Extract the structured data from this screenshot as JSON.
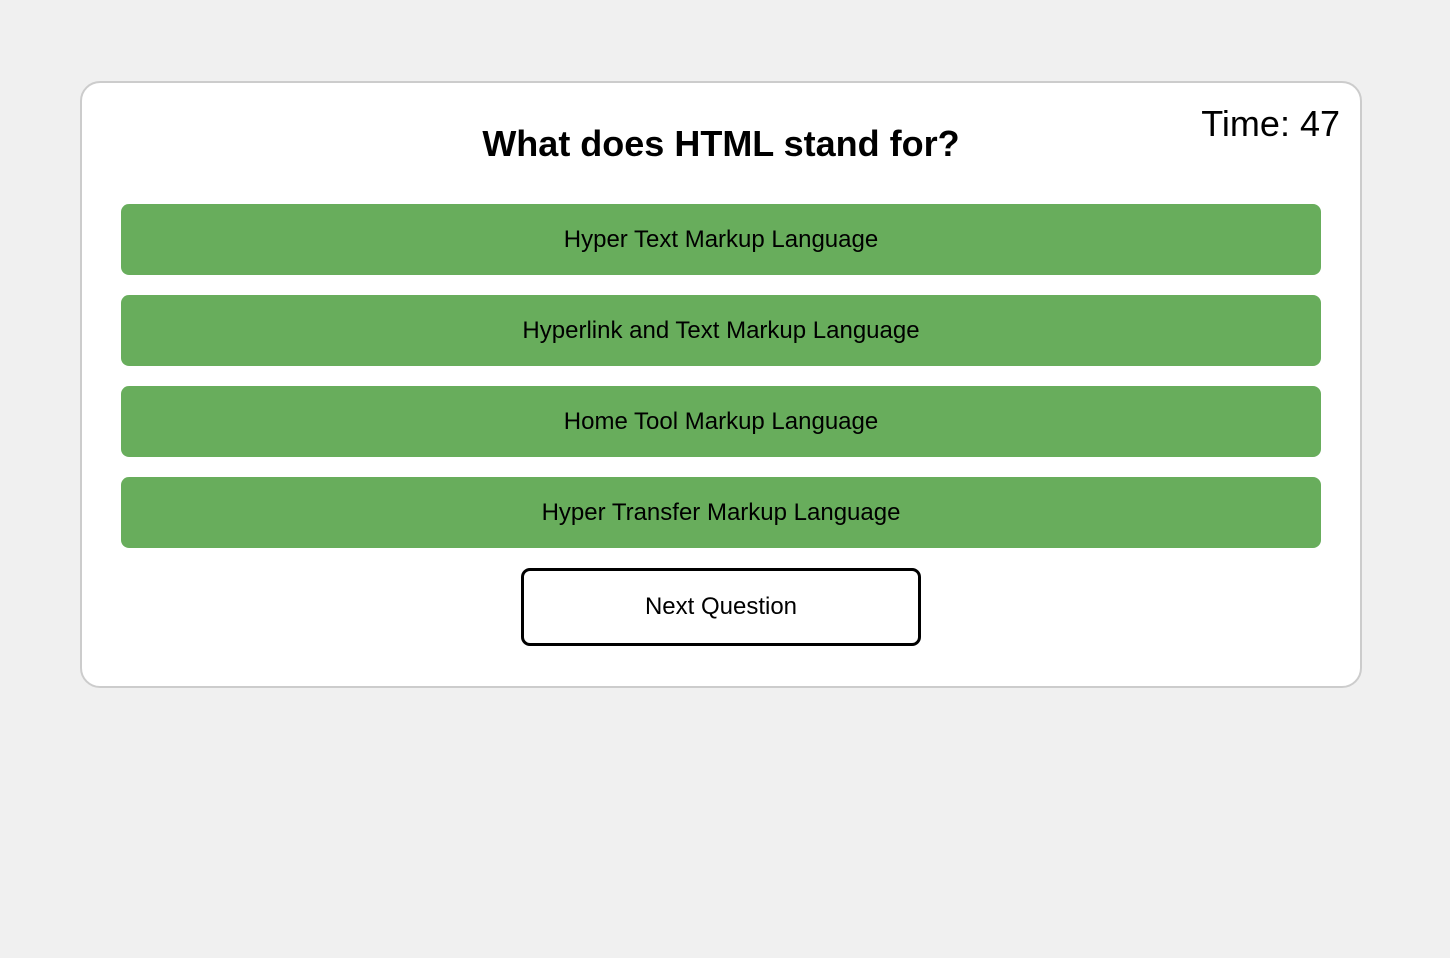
{
  "quiz": {
    "timer_text": "Time: 47",
    "question": "What does HTML stand for?",
    "options": [
      {
        "label": "Hyper Text Markup Language"
      },
      {
        "label": "Hyperlink and Text Markup Language"
      },
      {
        "label": "Home Tool Markup Language"
      },
      {
        "label": "Hyper Transfer Markup Language"
      }
    ],
    "next_label": "Next Question"
  },
  "colors": {
    "option_bg": "#68ad5c",
    "page_bg": "#f0f0f0",
    "card_border": "#cccccc"
  }
}
